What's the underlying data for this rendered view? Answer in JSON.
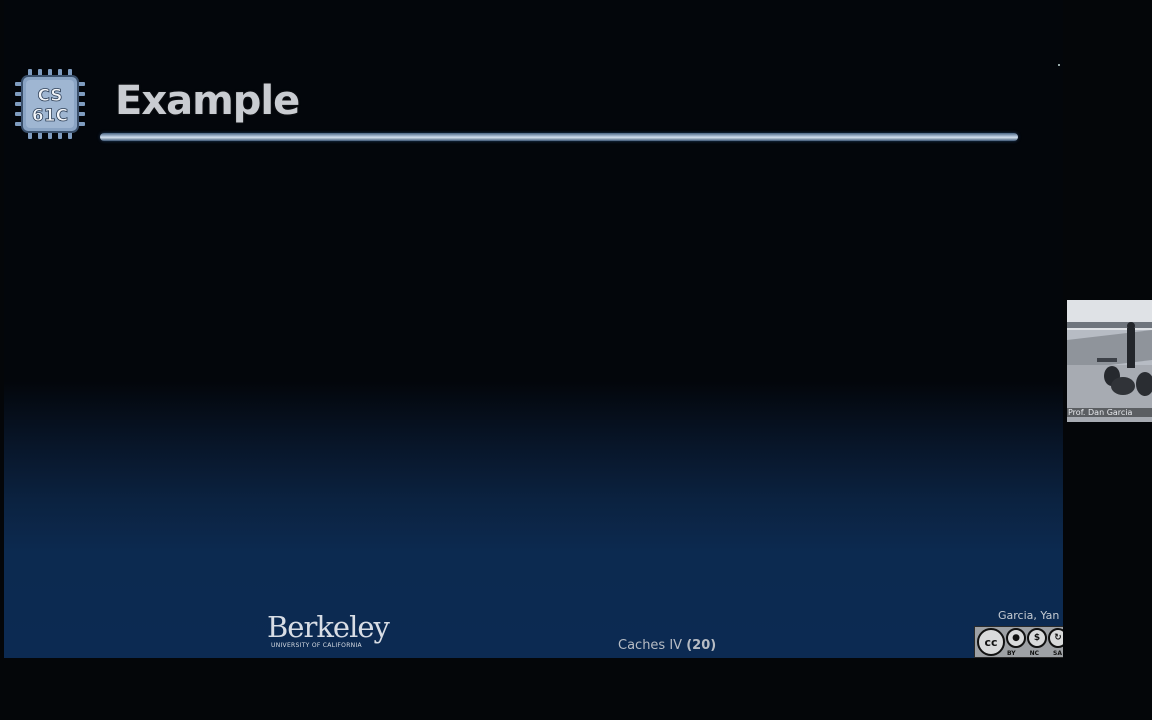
{
  "slide": {
    "title": "Example",
    "logo": {
      "line1": "CS",
      "line2": "61C",
      "icon": "cs61c-chip-logo"
    },
    "footer": {
      "institution": {
        "name": "Berkeley",
        "subtitle": "UNIVERSITY OF CALIFORNIA"
      },
      "lecture": "Caches IV",
      "slide_number": "(20)",
      "authors": "Garcia, Yan",
      "license": {
        "icon": "cc-by-nc-sa-icon",
        "labels": [
          "BY",
          "NC",
          "SA"
        ],
        "cc": "cc"
      }
    }
  },
  "webcam": {
    "caption": "Prof. Dan Garcia"
  },
  "colors": {
    "title": "#c9ccd1",
    "rule": "#b9cbe0",
    "slide_bottom": "#0c2a52"
  }
}
